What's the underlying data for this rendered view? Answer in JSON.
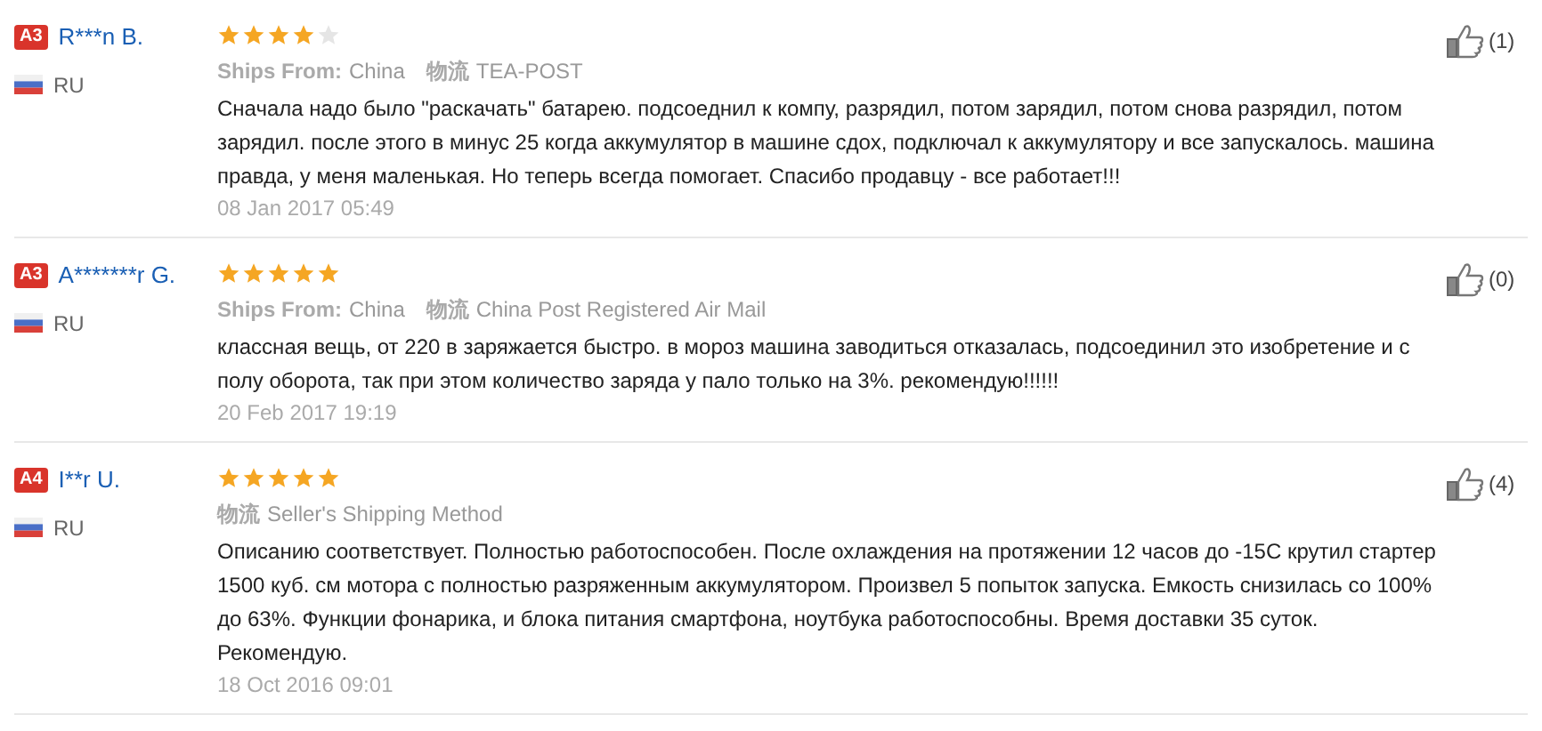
{
  "reviews": [
    {
      "level_badge": "A3",
      "name": "R***n B.",
      "country": "RU",
      "stars": 4,
      "ships_from_label": "Ships From:",
      "ships_from": "China",
      "logistics_label": "物流",
      "logistics": "TEA-POST",
      "text": "Сначала надо было \"раскачать\" батарею. подсоеднил к компу, разрядил, потом зарядил, потом снова разрядил, потом зарядил. после этого в минус 25 когда аккумулятор в машине сдох, подключал к аккумулятору и все запускалось. машина правда, у меня маленькая. Но теперь всегда помогает. Спасибо продавцу - все работает!!!",
      "date": "08 Jan 2017 05:49",
      "likes": "(1)"
    },
    {
      "level_badge": "A3",
      "name": "A*******r G.",
      "country": "RU",
      "stars": 5,
      "ships_from_label": "Ships From:",
      "ships_from": "China",
      "logistics_label": "物流",
      "logistics": "China Post Registered Air Mail",
      "text": "классная вещь, от 220 в заряжается быстро. в мороз машина заводиться отказалась, подсоединил это изобретение и с полу оборота, так при этом количество заряда у пало только на 3%. рекомендую!!!!!!",
      "date": "20 Feb 2017 19:19",
      "likes": "(0)"
    },
    {
      "level_badge": "A4",
      "name": "I**r U.",
      "country": "RU",
      "stars": 5,
      "logistics_label": "物流",
      "logistics": "Seller's Shipping Method",
      "text": "Описанию соответствует. Полностью работоспособен. После охлаждения на протяжении 12 часов до -15С крутил стартер 1500 куб. см мотора с полностью разряженным аккумулятором. Произвел 5 попыток запуска. Емкость снизилась со 100% до 63%. Функции фонарика, и блока питания смартфона, ноутбука работоспособны. Время доставки 35 суток. Рекомендую.",
      "date": "18 Oct 2016 09:01",
      "likes": "(4)"
    }
  ]
}
